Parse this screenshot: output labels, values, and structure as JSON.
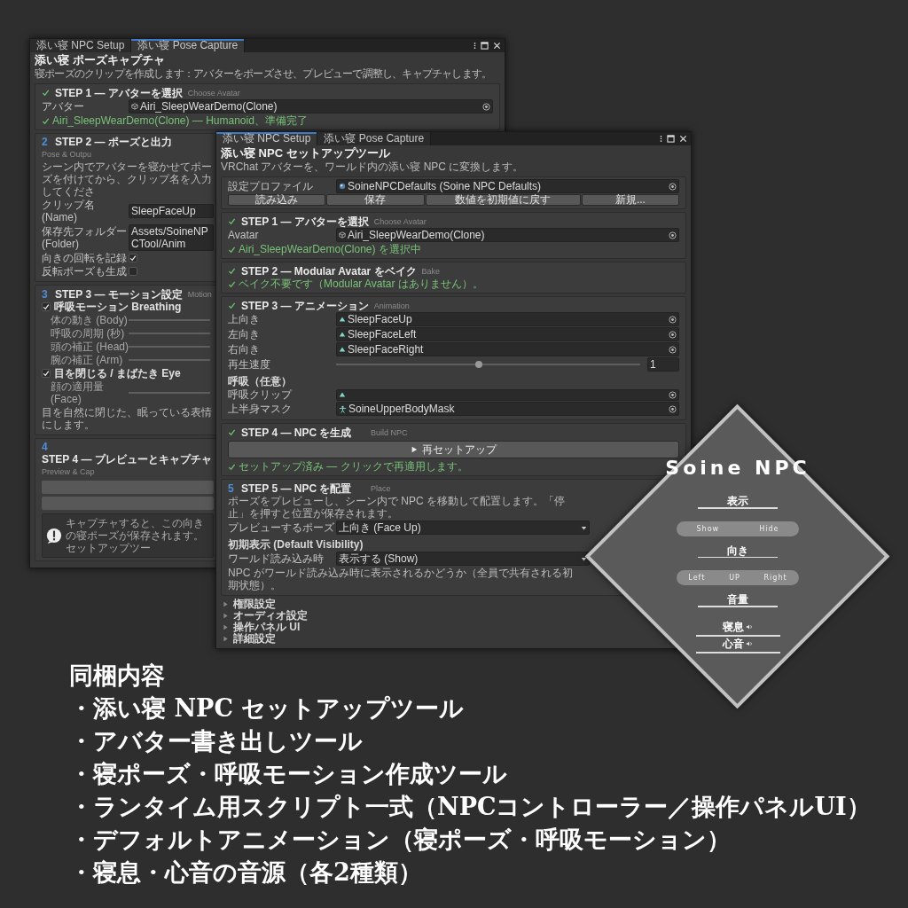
{
  "back_window": {
    "tabs": [
      {
        "label": "添い寝 NPC Setup",
        "selected": false
      },
      {
        "label": "添い寝 Pose Capture",
        "selected": true
      }
    ],
    "title": "添い寝 ポーズキャプチャ",
    "description": "寝ポーズのクリップを作成します：アバターをポーズさせ、プレビューで調整し、キャプチャします。",
    "sections": [
      {
        "done": true,
        "title": "STEP 1 — アバターを選択",
        "subtitle": "Choose Avatar",
        "rows": [
          {
            "kind": "avatar",
            "label": "アバター",
            "value": "Airi_SleepWearDemo(Clone)"
          },
          {
            "kind": "status",
            "text": "Airi_SleepWearDemo(Clone) — Humanoid、準備完了"
          }
        ]
      },
      {
        "done": false,
        "number": "2",
        "title": "STEP 2 — ポーズと出力",
        "subtitle": "Pose & Outpu",
        "rows": [
          {
            "kind": "hint",
            "text": "シーン内でアバターを寝かせてポーズを付けてから、クリップ名を入力してくださ"
          },
          {
            "kind": "text",
            "label": "クリップ名 (Name)",
            "value": "SleepFaceUp"
          },
          {
            "kind": "text",
            "label": "保存先フォルダー (Folder)",
            "value": "Assets/SoineNPCTool/Anim"
          },
          {
            "kind": "checkbox",
            "label": "向きの回転を記録",
            "checked": true
          },
          {
            "kind": "checkbox",
            "label": "反転ポーズも生成",
            "checked": false
          }
        ]
      },
      {
        "done": false,
        "number": "3",
        "title": "STEP 3 — モーション設定",
        "subtitle": "Motion",
        "rows": [
          {
            "kind": "toggle",
            "label": "呼吸モーション Breathing",
            "checked": true
          },
          {
            "kind": "slider",
            "label": "体の動き (Body)"
          },
          {
            "kind": "slider",
            "label": "呼吸の周期 (秒)"
          },
          {
            "kind": "slider",
            "label": "頭の補正 (Head)"
          },
          {
            "kind": "slider",
            "label": "腕の補正 (Arm)"
          },
          {
            "kind": "toggle",
            "label": "目を閉じる / まばたき Eye",
            "checked": true
          },
          {
            "kind": "slider",
            "label": "顔の適用量 (Face)"
          },
          {
            "kind": "hint",
            "text": "目を自然に閉じた、眠っている表情にします。"
          }
        ]
      },
      {
        "done": false,
        "number": "4",
        "title": "STEP 4 — プレビューとキャプチャ",
        "subtitle": "Preview & Cap",
        "rows": [
          {
            "kind": "button"
          },
          {
            "kind": "button"
          },
          {
            "kind": "info",
            "text": "キャプチャすると、この向きの寝ポーズが保存されます。セットアップツー"
          }
        ]
      }
    ]
  },
  "front_window": {
    "tabs": [
      {
        "label": "添い寝 NPC Setup",
        "selected": true
      },
      {
        "label": "添い寝 Pose Capture",
        "selected": false
      }
    ],
    "title": "添い寝 NPC セットアップツール",
    "description": "VRChat アバターを、ワールド内の添い寝 NPC に変換します。",
    "profile": {
      "label": "設定プロファイル",
      "value": "SoineNPCDefaults (Soine NPC Defaults)",
      "buttons": [
        "読み込み",
        "保存",
        "数値を初期値に戻す",
        "新規..."
      ]
    },
    "sections": [
      {
        "done": true,
        "title": "STEP 1 — アバターを選択",
        "subtitle": "Choose Avatar",
        "rows": [
          {
            "kind": "avatar",
            "label": "Avatar",
            "value": "Airi_SleepWearDemo(Clone)"
          },
          {
            "kind": "status",
            "text": "Airi_SleepWearDemo(Clone) を選択中"
          }
        ]
      },
      {
        "done": true,
        "title": "STEP 2 — Modular Avatar をベイク",
        "subtitle": "Bake",
        "rows": [
          {
            "kind": "status",
            "text": "ベイク不要です（Modular Avatar はありません）。"
          }
        ]
      },
      {
        "done": true,
        "title": "STEP 3 — アニメーション",
        "subtitle": "Animation",
        "rows": [
          {
            "kind": "clip",
            "label": "上向き",
            "value": "SleepFaceUp"
          },
          {
            "kind": "clip",
            "label": "左向き",
            "value": "SleepFaceLeft"
          },
          {
            "kind": "clip",
            "label": "右向き",
            "value": "SleepFaceRight"
          },
          {
            "kind": "slider",
            "label": "再生速度",
            "level": 0.47,
            "reading": "1"
          },
          {
            "kind": "subheading",
            "text": "呼吸（任意）"
          },
          {
            "kind": "clip",
            "label": "呼吸クリップ"
          },
          {
            "kind": "mask",
            "label": "上半身マスク",
            "value": "SoineUpperBodyMask"
          }
        ]
      },
      {
        "done": true,
        "title": "STEP 4 — NPC を生成",
        "subtitle": "Build NPC",
        "rows": [
          {
            "kind": "run",
            "label": "再セットアップ"
          },
          {
            "kind": "status",
            "text": "セットアップ済み — クリックで再適用します。"
          }
        ]
      },
      {
        "done": false,
        "number": "5",
        "title": "STEP 5 — NPC を配置",
        "subtitle": "Place",
        "rows": [
          {
            "kind": "hint",
            "text": "ポーズをプレビューし、シーン内で NPC を移動して配置します。「停止」を押すと位置が保存されます。"
          },
          {
            "kind": "dropdown",
            "label": "プレビューするポーズ",
            "value": "上向き (Face Up)"
          },
          {
            "kind": "subheading",
            "text": "初期表示 (Default Visibility)"
          },
          {
            "kind": "dropdown",
            "label": "ワールド読み込み時",
            "value": "表示する (Show)"
          },
          {
            "kind": "hint",
            "text": "NPC がワールド読み込み時に表示されるかどうか（全員で共有される初期状態）。"
          }
        ]
      }
    ],
    "foldouts": [
      {
        "label": "権限設定",
        "expanded": false
      },
      {
        "label": "オーディオ設定",
        "expanded": false
      },
      {
        "label": "操作パネル UI",
        "expanded": false
      },
      {
        "label": "詳細設定",
        "expanded": false
      }
    ]
  },
  "control_panel": {
    "title": "Soine NPC",
    "groups": [
      {
        "kind": "options",
        "label": "表示",
        "options": [
          "Show",
          "Hide"
        ]
      },
      {
        "kind": "options",
        "label": "向き",
        "options": [
          "Left",
          "UP",
          "Right"
        ]
      },
      {
        "kind": "volumes",
        "label": "音量",
        "sliders": [
          {
            "label": "寝息",
            "level": 1
          },
          {
            "label": "心音",
            "level": 1
          }
        ]
      }
    ]
  },
  "contents": {
    "heading": "同梱内容",
    "items": [
      "・添い寝 NPC セットアップツール",
      "・アバター書き出しツール",
      "・寝ポーズ・呼吸モーション作成ツール",
      "・ランタイム用スクリプト一式（NPCコントローラー／操作パネルUI）",
      "・デフォルトアニメーション（寝ポーズ・呼吸モーション）",
      "・寝息・心音の音源（各2種類）"
    ]
  }
}
